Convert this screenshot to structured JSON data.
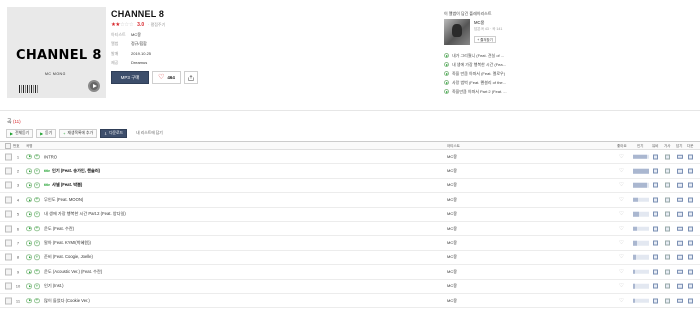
{
  "album": {
    "cover_title": "CHANNEL 8",
    "cover_artist": "MC MONG",
    "title": "CHANNEL 8",
    "stars_on": "★★",
    "stars_off": "☆☆☆",
    "score": "3.0",
    "rate_link": "· 평점주기",
    "meta": [
      {
        "key": "아티스트",
        "value": "MC몽"
      },
      {
        "key": "앨범",
        "value": "정규/힙합"
      },
      {
        "key": "발매",
        "value": "2019.10.25"
      },
      {
        "key": "제공",
        "value": "Dreamus"
      }
    ],
    "mp3_button": "MP3 구매",
    "like_count": "464"
  },
  "playlist": {
    "heading": "이 앨범이 담긴 플레이리스트",
    "name": "MC몽",
    "info": "담은곡 43 · 곡 141",
    "fav_button": "+ 즐겨찾기",
    "items": [
      "내가 그리웠니 (Feat. 견실 of ...",
      "내 생에 가장 행복한 시간 (Fea...",
      "죽을 만큼 아파서 (Feat. 멜로우)",
      "사랑 범벅 (Feat. 퀜셜리 of the...",
      "죽을만큼 아파서 Part 2 (Feat. ..."
    ]
  },
  "tracklist": {
    "title": "곡",
    "count": "(11)",
    "toolbar": {
      "select_all": "전체듣기",
      "play": "듣기",
      "add_playlist": "재생목록에 추가",
      "download": "다운로드",
      "my_list": "내 리스트에 담기"
    },
    "columns": {
      "number": "번호",
      "song": "곡명",
      "artist": "아티스트",
      "like": "좋아요",
      "popularity": "인기",
      "lyrics": "뮤비",
      "mv": "가사",
      "buy": "담기",
      "ringtone": "다운"
    },
    "title_badge": "title",
    "tracks": [
      {
        "num": "1",
        "title": "INTRO",
        "artist": "MC몽",
        "is_title": false,
        "popularity": 0.85
      },
      {
        "num": "2",
        "title": "인기 (Feat. 송가인, 챈슬러)",
        "artist": "MC몽",
        "is_title": true,
        "popularity": 1.0
      },
      {
        "num": "3",
        "title": "샤넬 (Feat. 박봄)",
        "artist": "MC몽",
        "is_title": true,
        "popularity": 0.9
      },
      {
        "num": "4",
        "title": "무인도 (Feat. MOON)",
        "artist": "MC몽",
        "is_title": false,
        "popularity": 0.3
      },
      {
        "num": "5",
        "title": "내 생에 가장 행복한 시간 Part.2 (Feat. 양다일)",
        "artist": "MC몽",
        "is_title": false,
        "popularity": 0.35
      },
      {
        "num": "6",
        "title": "운도 (Feat. 수란)",
        "artist": "MC몽",
        "is_title": false,
        "popularity": 0.25
      },
      {
        "num": "7",
        "title": "말아 (Feat. KYMI(박혜원))",
        "artist": "MC몽",
        "is_title": false,
        "popularity": 0.28
      },
      {
        "num": "8",
        "title": "준비 (Feat. Coogie, Joelle)",
        "artist": "MC몽",
        "is_title": false,
        "popularity": 0.2
      },
      {
        "num": "9",
        "title": "운도 (Acoustic Ver.) (Feat. 수란)",
        "artist": "MC몽",
        "is_title": false,
        "popularity": 0.15
      },
      {
        "num": "10",
        "title": "인기 (Inst.)",
        "artist": "MC몽",
        "is_title": false,
        "popularity": 0.1
      },
      {
        "num": "11",
        "title": "많이 들었다 (Cookie Ver.)",
        "artist": "MC몽",
        "is_title": false,
        "popularity": 0.12
      }
    ]
  },
  "colors": {
    "accent_red": "#d7262b",
    "play_green": "#1a9e2a",
    "navy_button": "#3d4e6b"
  }
}
